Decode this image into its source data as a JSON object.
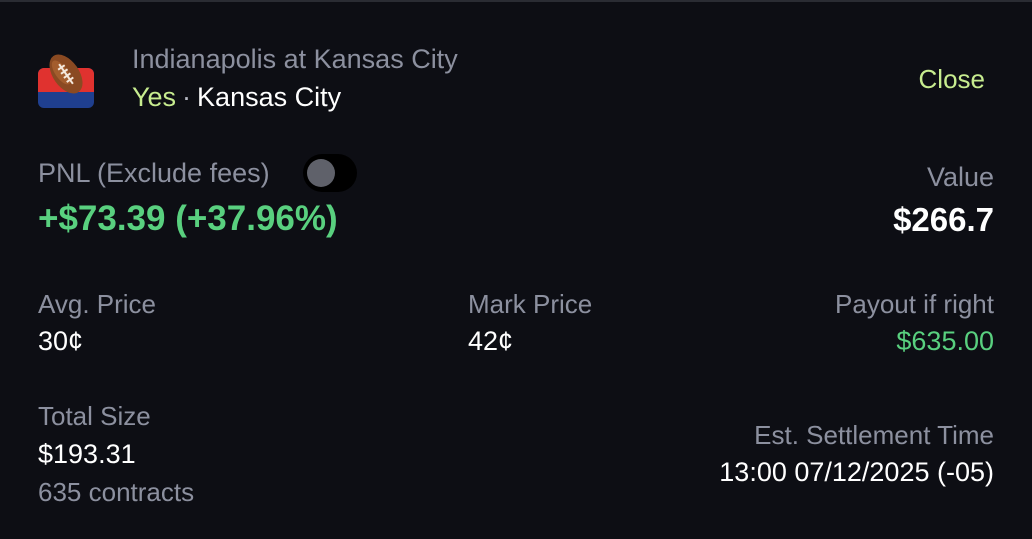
{
  "market": {
    "title": "Indianapolis at Kansas City",
    "side": "Yes",
    "separator": "·",
    "team": "Kansas City",
    "icon": "football-icon"
  },
  "close_label": "Close",
  "pnl": {
    "label": "PNL (Exclude fees)",
    "value": "+$73.39 (+37.96%)",
    "toggle_on": false
  },
  "value": {
    "label": "Value",
    "amount": "$266.7"
  },
  "avg_price": {
    "label": "Avg. Price",
    "value": "30¢"
  },
  "mark_price": {
    "label": "Mark Price",
    "value": "42¢"
  },
  "payout": {
    "label": "Payout if right",
    "value": "$635.00"
  },
  "total_size": {
    "label": "Total Size",
    "value": "$193.31",
    "contracts": "635 contracts"
  },
  "settlement": {
    "label": "Est. Settlement Time",
    "value": "13:00 07/12/2025 (-05)"
  },
  "colors": {
    "background": "#0d0e14",
    "positive": "#59d07f",
    "side_yes": "#c7ec8f",
    "close": "#c7ec8f",
    "muted": "#8c909f"
  }
}
